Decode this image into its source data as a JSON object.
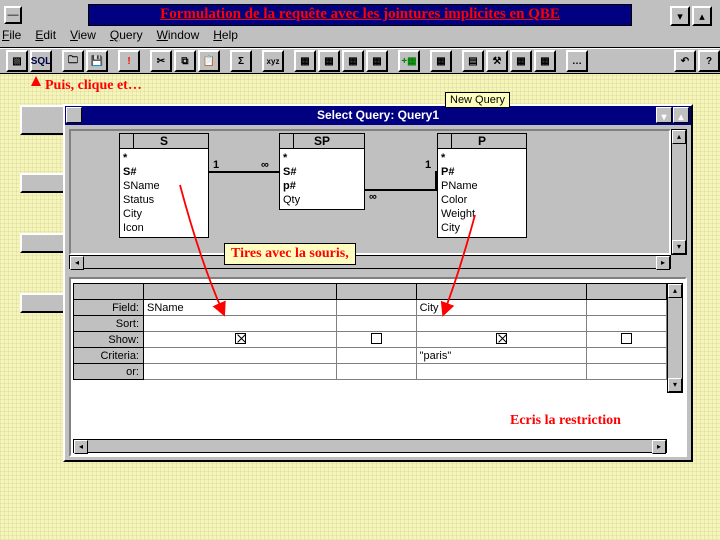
{
  "banner": "Formulation de la requête avec les jointures implicites en QBE",
  "menus": {
    "file": "File",
    "edit": "Edit",
    "view": "View",
    "query": "Query",
    "window": "Window",
    "help": "Help"
  },
  "toolbar_items": [
    "des",
    "SQL",
    "open",
    "save",
    "!",
    "cut",
    "copy",
    "paste",
    "Σ",
    "tbl",
    "t1",
    "t2",
    "t3",
    "t4",
    "add",
    "new",
    "db",
    "tools",
    "sum",
    "help",
    "..."
  ],
  "tooltip": "New Query",
  "annotations": {
    "step1": "Puis, clique et…",
    "step2": "Tires avec la souris,",
    "step3": "Ecris la restriction"
  },
  "dialog": {
    "title": "Select Query: Query1",
    "tables": {
      "S": {
        "title": "S",
        "fields": [
          "*",
          "S#",
          "SName",
          "Status",
          "City",
          "Icon"
        ]
      },
      "SP": {
        "title": "SP",
        "fields": [
          "*",
          "S#",
          "p#",
          "Qty"
        ]
      },
      "P": {
        "title": "P",
        "fields": [
          "*",
          "P#",
          "PName",
          "Color",
          "Weight",
          "City"
        ]
      }
    },
    "joins": {
      "one": "1",
      "many": "∞"
    }
  },
  "grid": {
    "rows": [
      "Field:",
      "Sort:",
      "Show:",
      "Criteria:",
      "or:"
    ],
    "field": {
      "c1": "SName",
      "c2": "",
      "c3": "City",
      "c4": ""
    },
    "show": {
      "c1": true,
      "c2": false,
      "c3": true,
      "c4": false
    },
    "criteria": {
      "c1": "",
      "c2": "",
      "c3": "\"paris\"",
      "c4": ""
    }
  }
}
